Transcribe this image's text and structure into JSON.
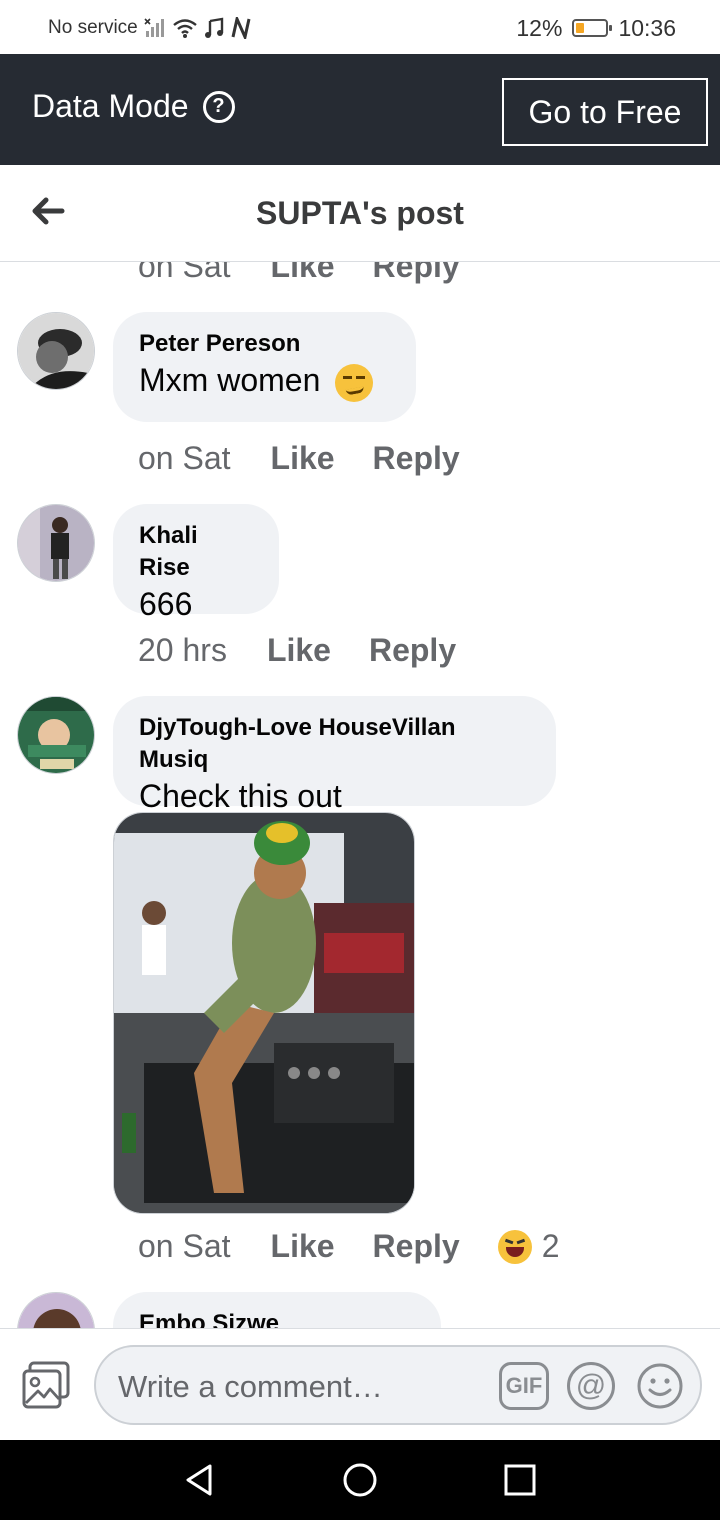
{
  "status_bar": {
    "carrier": "No service",
    "battery_percent": "12%",
    "battery_level": 0.12,
    "time": "10:36"
  },
  "data_mode": {
    "title": "Data Mode",
    "help_symbol": "?",
    "go_free_label": "Go to Free"
  },
  "header": {
    "title": "SUPTA's post"
  },
  "comments": {
    "top_meta": {
      "time": "on Sat",
      "like": "Like",
      "reply": "Reply"
    },
    "items": [
      {
        "author": "Peter Pereson",
        "text": "Mxm women",
        "time": "on Sat",
        "like": "Like",
        "reply": "Reply"
      },
      {
        "author": "Khali Rise",
        "text": "666",
        "time": "20 hrs",
        "like": "Like",
        "reply": "Reply"
      },
      {
        "author": "DjyTough-Love HouseVillan Musiq",
        "text": "Check this out",
        "time": "on Sat",
        "like": "Like",
        "reply": "Reply",
        "reaction_count": "2"
      },
      {
        "author": "Embo Sizwe"
      }
    ]
  },
  "composer": {
    "placeholder": "Write a comment…",
    "gif_label": "GIF",
    "at_label": "@"
  },
  "icons": {
    "back": "back-arrow-icon",
    "photo": "photo-icon",
    "emoji": "smile-icon",
    "reaction": "laughing-emoji-icon"
  },
  "colors": {
    "data_bar": "#262b33",
    "bubble": "#f0f2f5",
    "meta_text": "#65676b",
    "battery_fill": "#f5a623"
  }
}
